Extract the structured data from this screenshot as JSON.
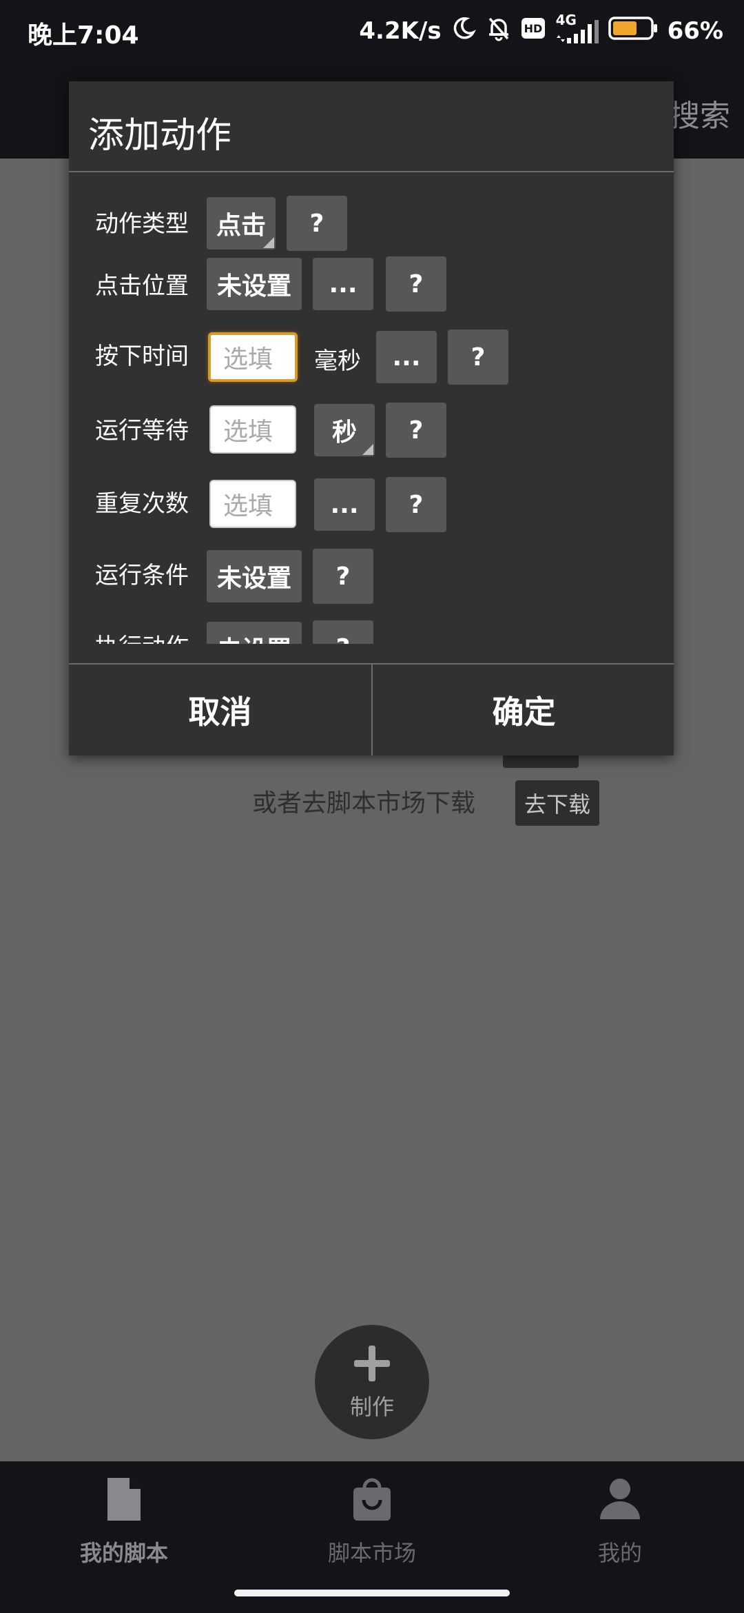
{
  "status_bar": {
    "time": "晚上7:04",
    "network_speed": "4.2K/s",
    "hd": "HD",
    "network_type": "4G",
    "battery": "66%",
    "battery_level": 0.66,
    "icons": [
      "moon-icon",
      "bell-muted-icon",
      "hd-icon",
      "signal-icon",
      "battery-icon"
    ]
  },
  "header": {
    "search": "搜索"
  },
  "page": {
    "text": "或者去脚本市场下载",
    "download_button": "去下载",
    "fab_label": "制作"
  },
  "bottom_nav": {
    "items": [
      {
        "label": "我的脚本",
        "icon": "document-icon",
        "active": true
      },
      {
        "label": "脚本市场",
        "icon": "shopping-bag-icon",
        "active": false
      },
      {
        "label": "我的",
        "icon": "person-icon",
        "active": false
      }
    ]
  },
  "dialog": {
    "title": "添加动作",
    "rows": {
      "action_type": {
        "label": "动作类型",
        "value": "点击",
        "help": "?"
      },
      "click_position": {
        "label": "点击位置",
        "value": "未设置",
        "more": "...",
        "help": "?"
      },
      "press_time": {
        "label": "按下时间",
        "placeholder": "选填",
        "unit": "毫秒",
        "more": "...",
        "help": "?"
      },
      "run_wait": {
        "label": "运行等待",
        "placeholder": "选填",
        "unit": "秒",
        "help": "?"
      },
      "repeat_count": {
        "label": "重复次数",
        "placeholder": "选填",
        "more": "...",
        "help": "?"
      },
      "run_condition": {
        "label": "运行条件",
        "value": "未设置",
        "help": "?"
      },
      "partial_row": {
        "label": "执行动作",
        "value": "未设置",
        "help": "?"
      }
    },
    "cancel": "取消",
    "confirm": "确定"
  },
  "colors": {
    "dialog_bg": "#313131",
    "button_bg": "#575757",
    "overlay": "#646464",
    "focus_border": "#d99a2b",
    "battery_fill": "#f0a62a"
  }
}
